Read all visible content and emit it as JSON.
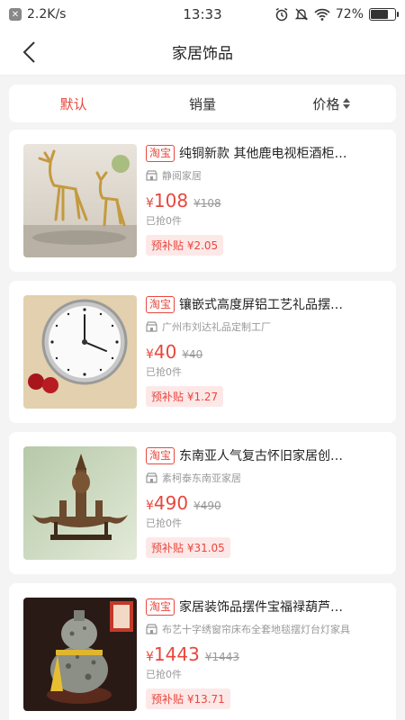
{
  "status_bar": {
    "net_speed": "2.2K/s",
    "time": "13:33",
    "battery": "72%",
    "battery_level": 0.72
  },
  "header": {
    "title": "家居饰品"
  },
  "sort_tabs": [
    {
      "label": "默认",
      "active": true
    },
    {
      "label": "销量",
      "active": false
    },
    {
      "label": "价格",
      "active": false
    }
  ],
  "products": [
    {
      "platform": "淘宝",
      "title": "纯铜新款 其他鹿电视柜酒柜…",
      "shop": "静阅家居",
      "currency": "¥",
      "price": "108",
      "original_price": "¥108",
      "sold": "已抢0件",
      "subsidy": "预补贴 ¥2.05",
      "image": "deer-statue-icon"
    },
    {
      "platform": "淘宝",
      "title": "镶嵌式高度屏铝工艺礼品摆…",
      "shop": "广州市刘达礼品定制工厂",
      "currency": "¥",
      "price": "40",
      "original_price": "¥40",
      "sold": "已抢0件",
      "subsidy": "预补贴 ¥1.27",
      "image": "clock-insert-icon"
    },
    {
      "platform": "淘宝",
      "title": "东南亚人气复古怀旧家居创…",
      "shop": "素柯泰东南亚家居",
      "currency": "¥",
      "price": "490",
      "original_price": "¥490",
      "sold": "已抢0件",
      "subsidy": "预补贴 ¥31.05",
      "image": "boat-sculpture-icon"
    },
    {
      "platform": "淘宝",
      "title": "家居装饰品摆件宝福禄葫芦…",
      "shop": "布艺十字绣窗帘床布全套地毯摆灯台灯家具",
      "currency": "¥",
      "price": "1443",
      "original_price": "¥1443",
      "sold": "已抢0件",
      "subsidy": "预补贴 ¥13.71",
      "image": "gourd-vase-icon"
    }
  ]
}
